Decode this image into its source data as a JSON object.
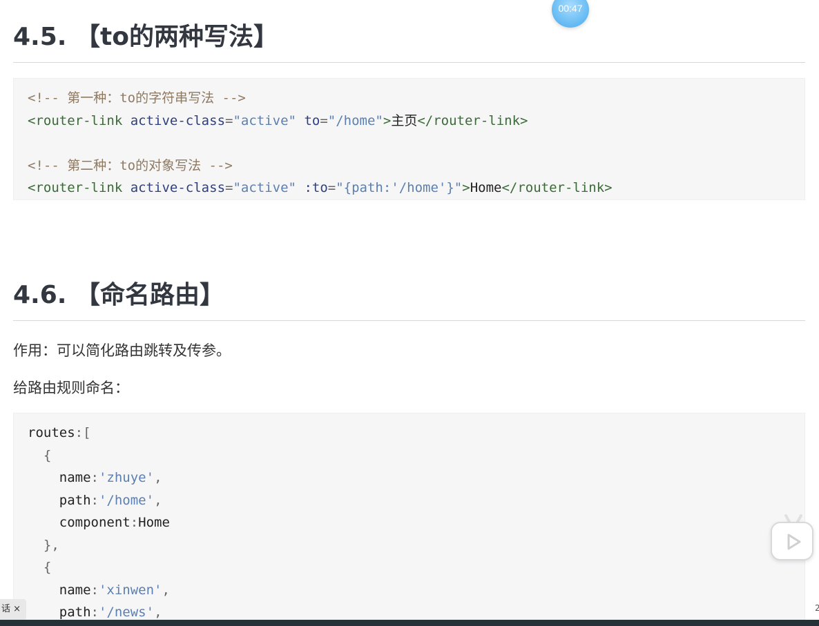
{
  "sections": [
    {
      "number": "4.5.",
      "title": "【to的两种写法】"
    },
    {
      "number": "4.6.",
      "title": "【命名路由】"
    }
  ],
  "code1": {
    "comment1": "<!-- 第一种：to的字符串写法 -->",
    "line1": {
      "tag_open": "<router-link",
      "attr1": "active-class",
      "val1": "\"active\"",
      "attr2": "to",
      "val2": "\"/home\"",
      "text": "主页",
      "tag_close": "</router-link>"
    },
    "comment2": "<!-- 第二种：to的对象写法 -->",
    "line2": {
      "tag_open": "<router-link",
      "attr1": "active-class",
      "val1": "\"active\"",
      "attr2": ":to",
      "val2": "\"{path:'/home'}\"",
      "text": "Home",
      "tag_close": "</router-link>"
    }
  },
  "paragraphs": {
    "purpose": "作用：可以简化路由跳转及传参。",
    "naming": "给路由规则命名："
  },
  "code2": {
    "routes": "routes",
    "route1": {
      "name_key": "name",
      "name_val": "'zhuye'",
      "path_key": "path",
      "path_val": "'/home'",
      "comp_key": "component",
      "comp_val": "Home"
    },
    "route2": {
      "name_key": "name",
      "name_val": "'xinwen'",
      "path_key": "path",
      "path_val": "'/news'"
    }
  },
  "overlay": {
    "timer": "00:47",
    "tag_text": "话 ×",
    "edge_char": "2"
  }
}
